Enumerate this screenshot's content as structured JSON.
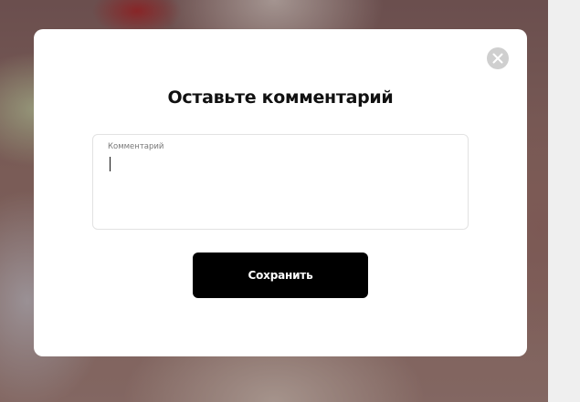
{
  "modal": {
    "title": "Оставьте комментарий",
    "comment_field": {
      "label": "Комментарий",
      "value": "",
      "placeholder": ""
    },
    "save_button_label": "Сохранить",
    "close_icon": "close-icon"
  },
  "colors": {
    "modal_background": "#ffffff",
    "button_background": "#000000",
    "button_text": "#ffffff",
    "close_button_background": "#cfcfcf",
    "overlay": "rgba(40,30,35,0.35)"
  }
}
